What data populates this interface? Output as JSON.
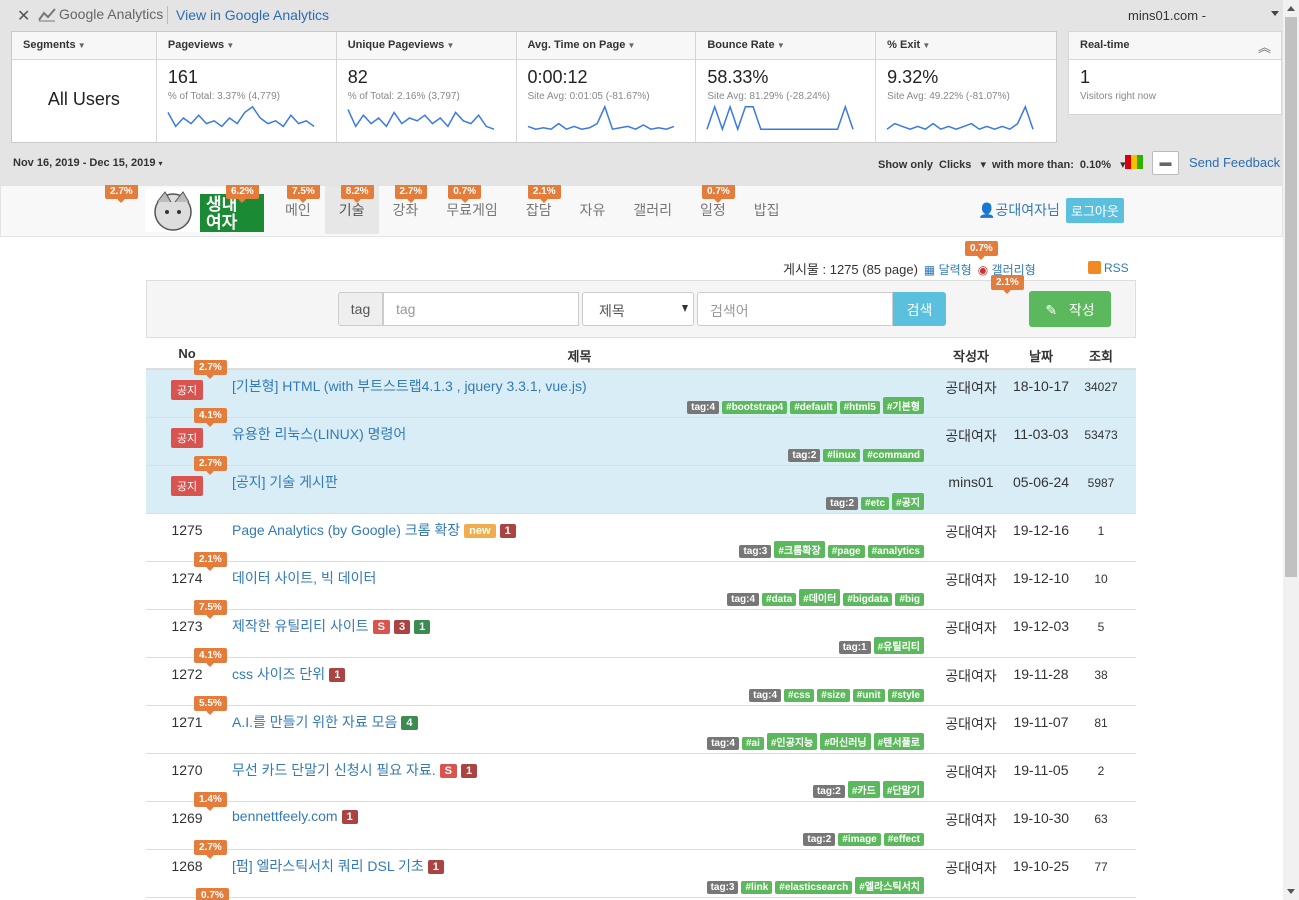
{
  "ga": {
    "close": "✕",
    "brand": "Google Analytics",
    "view_link": "View in Google Analytics",
    "site": "mins01.com -",
    "metrics": [
      {
        "id": "segments",
        "head": "Segments",
        "value": "All Users"
      },
      {
        "id": "pageviews",
        "head": "Pageviews",
        "value": "161",
        "sub": "% of Total: 3.37% (4,779)",
        "spark": [
          0.7,
          0.2,
          0.5,
          0.3,
          0.6,
          0.3,
          0.4,
          0.2,
          0.5,
          0.3,
          0.7,
          0.9,
          0.5,
          0.3,
          0.4,
          0.2,
          0.6,
          0.3,
          0.4,
          0.2
        ]
      },
      {
        "id": "unique",
        "head": "Unique Pageviews",
        "value": "82",
        "sub": "% of Total: 2.16% (3,797)",
        "spark": [
          0.8,
          0.2,
          0.6,
          0.3,
          0.5,
          0.2,
          0.7,
          0.3,
          0.5,
          0.4,
          0.6,
          0.3,
          0.5,
          0.2,
          0.7,
          0.4,
          0.3,
          0.6,
          0.2,
          0.1
        ]
      },
      {
        "id": "avgtime",
        "head": "Avg. Time on Page",
        "value": "0:00:12",
        "sub": "Site Avg: 0:01:05 (-81.67%)",
        "spark": [
          0.2,
          0.1,
          0.15,
          0.1,
          0.3,
          0.1,
          0.2,
          0.1,
          0.15,
          0.3,
          0.9,
          0.1,
          0.15,
          0.2,
          0.1,
          0.25,
          0.1,
          0.15,
          0.1,
          0.2
        ]
      },
      {
        "id": "bounce",
        "head": "Bounce Rate",
        "value": "58.33%",
        "sub": "Site Avg: 81.29% (-28.24%)",
        "spark": [
          0.1,
          0.9,
          0.1,
          0.9,
          0.1,
          0.9,
          0.9,
          0.1,
          0.1,
          0.1,
          0.1,
          0.1,
          0.1,
          0.1,
          0.1,
          0.1,
          0.1,
          0.1,
          0.9,
          0.1
        ]
      },
      {
        "id": "exit",
        "head": "% Exit",
        "value": "9.32%",
        "sub": "Site Avg: 49.22% (-81.07%)",
        "spark": [
          0.1,
          0.3,
          0.2,
          0.1,
          0.2,
          0.1,
          0.3,
          0.1,
          0.2,
          0.1,
          0.2,
          0.3,
          0.1,
          0.2,
          0.1,
          0.2,
          0.1,
          0.3,
          0.9,
          0.1
        ]
      }
    ],
    "realtime": {
      "head": "Real-time",
      "value": "1",
      "sub": "Visitors right now",
      "chevron": "︽"
    },
    "date_range": "Nov 16, 2019 - Dec 15, 2019",
    "show_only": "Show only",
    "clicks": "Clicks",
    "more_than": "with more than:",
    "threshold": "0.10%",
    "send_feedback": "Send Feedback",
    "feedback_icon": "comment-icon"
  },
  "nav": {
    "logo_text": "생내\n여자",
    "menu": [
      {
        "label": "메인",
        "pct": "7.5%"
      },
      {
        "label": "기술",
        "pct": "8.2%",
        "active": true
      },
      {
        "label": "강좌",
        "pct": "2.7%"
      },
      {
        "label": "무료게임",
        "pct": "0.7%"
      },
      {
        "label": "잡담",
        "pct": "2.1%"
      },
      {
        "label": "자유"
      },
      {
        "label": "갤러리"
      },
      {
        "label": "일정",
        "pct": "0.7%"
      },
      {
        "label": "밥집"
      }
    ],
    "logo_pcts": [
      "2.7%",
      "6.2%"
    ],
    "user": "공대여자님",
    "logout": "로그아웃"
  },
  "board": {
    "info": "게시물 : 1275 (85 page)",
    "calendar": "달력형",
    "gallery": "갤러리형",
    "gallery_pct": "0.7%",
    "write_pct": "2.1%",
    "rss": "RSS",
    "search": {
      "tag_label": "tag",
      "tag_placeholder": "tag",
      "select": "제목",
      "keyword_placeholder": "검색어",
      "search_btn": "검색",
      "write_btn": "작성"
    },
    "headers": {
      "no": "No",
      "title": "제목",
      "author": "작성자",
      "date": "날짜",
      "views": "조회"
    },
    "rows": [
      {
        "no": "공지",
        "notice": true,
        "pct": "2.7%",
        "title": "[기본형] HTML (with 부트스트랩4.1.3 , jquery 3.3.1, vue.js)",
        "badges": [],
        "tags": [
          "tag:4",
          "#bootstrap4",
          "#default",
          "#html5",
          "#기본형"
        ],
        "author": "공대여자",
        "date": "18-10-17",
        "views": "34027"
      },
      {
        "no": "공지",
        "notice": true,
        "pct": "4.1%",
        "title": "유용한 리눅스(LINUX) 명령어",
        "badges": [],
        "tags": [
          "tag:2",
          "#linux",
          "#command"
        ],
        "author": "공대여자",
        "date": "11-03-03",
        "views": "53473"
      },
      {
        "no": "공지",
        "notice": true,
        "pct": "2.7%",
        "title": "[공지] 기술 게시판",
        "badges": [],
        "tags": [
          "tag:2",
          "#etc",
          "#공지"
        ],
        "author": "mins01",
        "date": "05-06-24",
        "views": "5987"
      },
      {
        "no": "1275",
        "pct": "",
        "title": "Page Analytics (by Google) 크롬 확장",
        "badges": [
          {
            "t": "new",
            "c": "b-new"
          },
          {
            "t": "1",
            "c": "b-n"
          }
        ],
        "tags": [
          "tag:3",
          "#크롬확장",
          "#page",
          "#analytics"
        ],
        "author": "공대여자",
        "date": "19-12-16",
        "views": "1"
      },
      {
        "no": "1274",
        "pct": "2.1%",
        "title": "데이터 사이트, 빅 데이터",
        "badges": [],
        "tags": [
          "tag:4",
          "#data",
          "#데이터",
          "#bigdata",
          "#big"
        ],
        "author": "공대여자",
        "date": "19-12-10",
        "views": "10"
      },
      {
        "no": "1273",
        "pct": "7.5%",
        "title": "제작한 유틸리티 사이트",
        "badges": [
          {
            "t": "S",
            "c": "b-s"
          },
          {
            "t": "3",
            "c": "b-n"
          },
          {
            "t": "1",
            "c": "b-g"
          }
        ],
        "tags": [
          "tag:1",
          "#유틸리티"
        ],
        "author": "공대여자",
        "date": "19-12-03",
        "views": "5"
      },
      {
        "no": "1272",
        "pct": "4.1%",
        "title": "css 사이즈 단위",
        "badges": [
          {
            "t": "1",
            "c": "b-n"
          }
        ],
        "tags": [
          "tag:4",
          "#css",
          "#size",
          "#unit",
          "#style"
        ],
        "author": "공대여자",
        "date": "19-11-28",
        "views": "38"
      },
      {
        "no": "1271",
        "pct": "5.5%",
        "title": "A.I.를 만들기 위한 자료 모음",
        "badges": [
          {
            "t": "4",
            "c": "b-g"
          }
        ],
        "tags": [
          "tag:4",
          "#ai",
          "#인공지능",
          "#머신러닝",
          "#텐서플로"
        ],
        "author": "공대여자",
        "date": "19-11-07",
        "views": "81"
      },
      {
        "no": "1270",
        "pct": "",
        "title": "무선 카드 단말기 신청시 필요 자료.",
        "badges": [
          {
            "t": "S",
            "c": "b-s"
          },
          {
            "t": "1",
            "c": "b-n"
          }
        ],
        "tags": [
          "tag:2",
          "#카드",
          "#단말기"
        ],
        "author": "공대여자",
        "date": "19-11-05",
        "views": "2"
      },
      {
        "no": "1269",
        "pct": "1.4%",
        "title": "bennettfeely.com",
        "badges": [
          {
            "t": "1",
            "c": "b-n"
          }
        ],
        "tags": [
          "tag:2",
          "#image",
          "#effect"
        ],
        "author": "공대여자",
        "date": "19-10-30",
        "views": "63"
      },
      {
        "no": "1268",
        "pct": "2.7%",
        "title": "[펌] 엘라스틱서치 쿼리 DSL 기초",
        "badges": [
          {
            "t": "1",
            "c": "b-n"
          }
        ],
        "tags": [
          "tag:3",
          "#link",
          "#elasticsearch",
          "#엘라스틱서치"
        ],
        "author": "공대여자",
        "date": "19-10-25",
        "views": "77"
      }
    ],
    "next_pct": "0.7%"
  }
}
